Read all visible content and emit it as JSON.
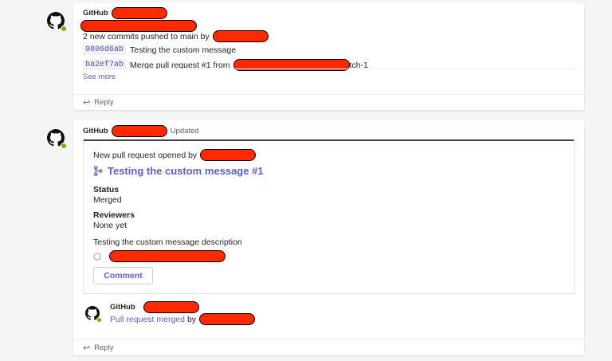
{
  "message1": {
    "sender": "GitHub",
    "summary_prefix": "2 new commits pushed to main by",
    "commits": [
      {
        "sha": "9806d6ab",
        "message": "Testing the custom message"
      },
      {
        "sha": "ba2ef7ab",
        "message": "Merge pull request #1 from",
        "message_suffix": "tch-1"
      }
    ],
    "see_more": "See more",
    "reply": "Reply"
  },
  "message2": {
    "sender": "GitHub",
    "updated": "Updated",
    "opened_by": "New pull request opened by",
    "pr_title": "Testing the custom message #1",
    "status_label": "Status",
    "status_value": "Merged",
    "reviewers_label": "Reviewers",
    "reviewers_value": "None yet",
    "description": "Testing the custom message description",
    "comment_button": "Comment",
    "reply_sender": "GitHub",
    "merged_link": "Pull request merged",
    "merged_by": "by",
    "reply": "Reply"
  },
  "colors": {
    "accent": "#5b5fc7",
    "presence": "#6bb700",
    "redaction": "#ff2a00"
  }
}
